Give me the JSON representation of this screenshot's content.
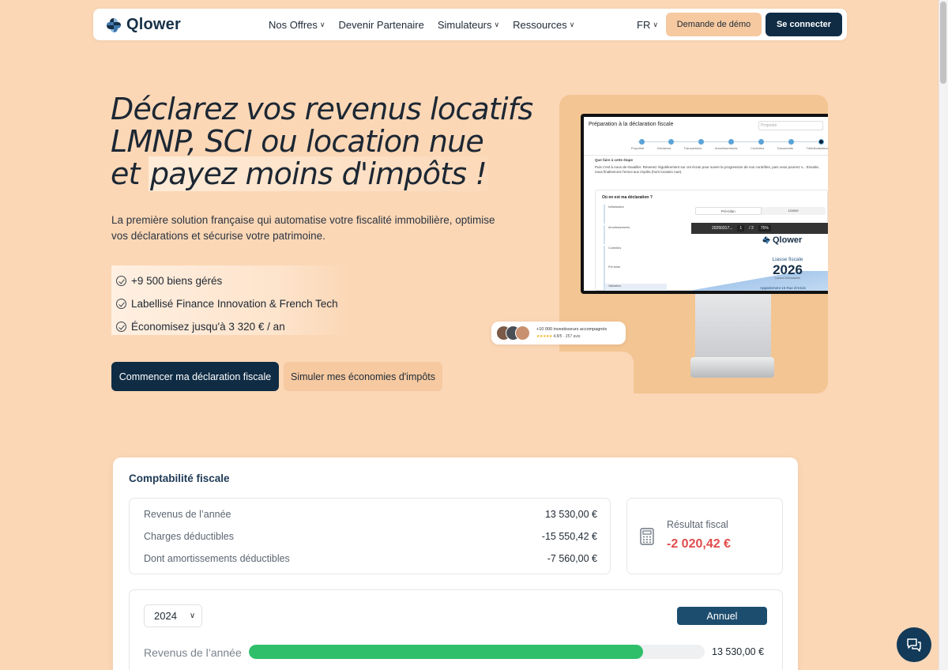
{
  "brand": {
    "name": "Qlower",
    "colors": {
      "navy": "#0f2c44",
      "peach": "#f6c9a0",
      "background": "#fbd7b6",
      "accent_blue": "#1d4d6e",
      "negative": "#e24b4b",
      "progress": "#2fbf6a"
    }
  },
  "nav": {
    "links": [
      {
        "label": "Nos Offres",
        "has_dropdown": true
      },
      {
        "label": "Devenir Partenaire",
        "has_dropdown": false
      },
      {
        "label": "Simulateurs",
        "has_dropdown": true
      },
      {
        "label": "Ressources",
        "has_dropdown": true
      }
    ],
    "lang": "FR",
    "demo_label": "Demande de démo",
    "login_label": "Se connecter",
    "chevron_icon": "chevron-down-icon"
  },
  "hero": {
    "title_line1": "Déclarez vos revenus locatifs",
    "title_line2": "LMNP, SCI ou location nue",
    "title_line3_a": "et ",
    "title_line3_b": "payez moins d'impôts !",
    "subtitle": "La première solution française qui automatise votre fiscalité immobilière, optimise vos déclarations et sécurise votre patrimoine.",
    "features": [
      {
        "text": "+9 500 biens gérés",
        "icon": "check-circle-icon"
      },
      {
        "text": "Labellisé Finance Innovation & French Tech",
        "icon": "check-circle-icon"
      },
      {
        "text": "Économisez jusqu'à 3 320 € / an",
        "icon": "check-circle-icon"
      }
    ],
    "cta_primary": "Commencer ma déclaration fiscale",
    "cta_secondary": "Simuler mes économies d'impôts"
  },
  "illustration": {
    "screen_title": "Préparation à la déclaration fiscale",
    "search_placeholder": "Propriété",
    "steps": [
      "Propriété",
      "Déclarant",
      "Transactions",
      "Amortissements",
      "Contrôles",
      "Documents",
      "Télédéclaration"
    ],
    "info_title": "Que faire à cette étape",
    "info_text": "Puis c'est à nous de travailler. Revenez régulièrement sur cet écran pour suivre la progression de nos contrôles, puis vous pourrez v... Ensuite, nous finaliserons l'envoi aux impôts (hors location nue).",
    "panel_title": "Où en est ma déclaration ?",
    "panel_items": [
      "Initialisation",
      "Amortissements",
      "Contrôles",
      "Pré-bilan",
      "Validation"
    ],
    "tabs": [
      "Pré-bilan",
      "Liasse"
    ],
    "pdf_file": "20250317...",
    "pdf_page": "1",
    "pdf_pages_total": "/ 2",
    "pdf_zoom": "75%",
    "pdf_logo": "Qlower",
    "pdf_liasse": "Liasse fiscale",
    "pdf_year": "2026",
    "pdf_owner": "Laurent Delassauble",
    "pdf_address": "Appartement 15 Rue d'Artois"
  },
  "badge": {
    "title": "+10 000 investisseurs accompagnés",
    "rating": "4.8/5 · 257 avis",
    "stars": "★★★★★"
  },
  "accounting": {
    "title": "Comptabilité fiscale",
    "rows": [
      {
        "label": "Revenus de l’année",
        "value": "13 530,00 €"
      },
      {
        "label": "Charges déductibles",
        "value": "-15 550,42 €"
      },
      {
        "label": "Dont amortissements déductibles",
        "value": "-7 560,00 €"
      }
    ],
    "result_label": "Résultat fiscal",
    "result_value": "-2 020,42 €",
    "result_icon": "calculator-icon",
    "year": "2024",
    "period_button": "Annuel",
    "bar_label": "Revenus de l’année",
    "bar_value": "13 530,00 €",
    "bar_fill_fraction": 0.865
  },
  "chat": {
    "icon": "chat-bubbles-icon"
  }
}
